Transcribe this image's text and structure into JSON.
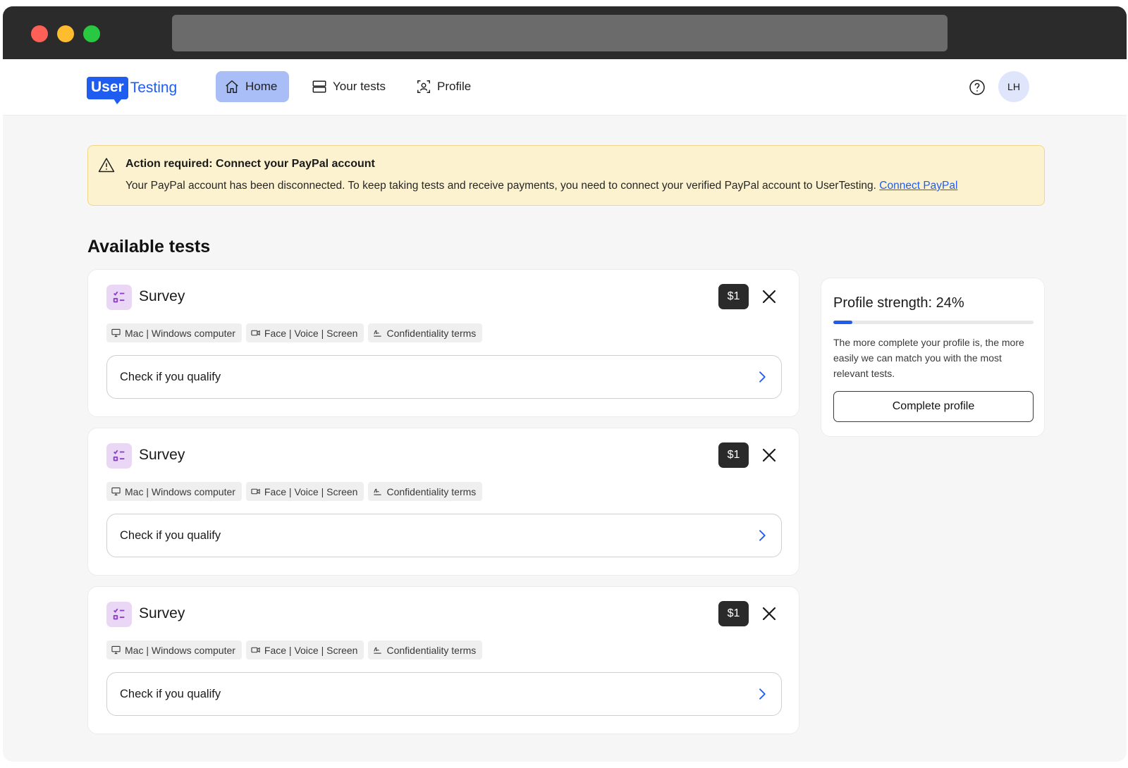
{
  "brand": {
    "logo_user": "User",
    "logo_testing": "Testing"
  },
  "nav": {
    "items": [
      {
        "label": "Home",
        "icon": "home-icon",
        "active": true
      },
      {
        "label": "Your tests",
        "icon": "stack-icon",
        "active": false
      },
      {
        "label": "Profile",
        "icon": "profile-icon",
        "active": false
      }
    ],
    "avatar_initials": "LH"
  },
  "banner": {
    "title": "Action required: Connect your PayPal account",
    "text": "Your PayPal account has been disconnected. To keep taking tests and receive payments, you need to connect your verified PayPal account to UserTesting.",
    "link": "Connect PayPal"
  },
  "section_title": "Available tests",
  "tests": [
    {
      "title": "Survey",
      "price": "$1",
      "tags": [
        "Mac | Windows computer",
        "Face | Voice | Screen",
        "Confidentiality terms"
      ],
      "cta": "Check if you qualify"
    },
    {
      "title": "Survey",
      "price": "$1",
      "tags": [
        "Mac | Windows computer",
        "Face | Voice | Screen",
        "Confidentiality terms"
      ],
      "cta": "Check if you qualify"
    },
    {
      "title": "Survey",
      "price": "$1",
      "tags": [
        "Mac | Windows computer",
        "Face | Voice | Screen",
        "Confidentiality terms"
      ],
      "cta": "Check if you qualify"
    }
  ],
  "profile_panel": {
    "title": "Profile strength: 24%",
    "strength_percent": 24,
    "text": "The more complete your profile is, the more easily we can match you with the most relevant tests.",
    "button": "Complete profile"
  },
  "colors": {
    "accent": "#1f5cf0",
    "nav_active": "#a9bdf7",
    "banner_bg": "#fdf2cf",
    "survey_icon_bg": "#ead7f5"
  }
}
